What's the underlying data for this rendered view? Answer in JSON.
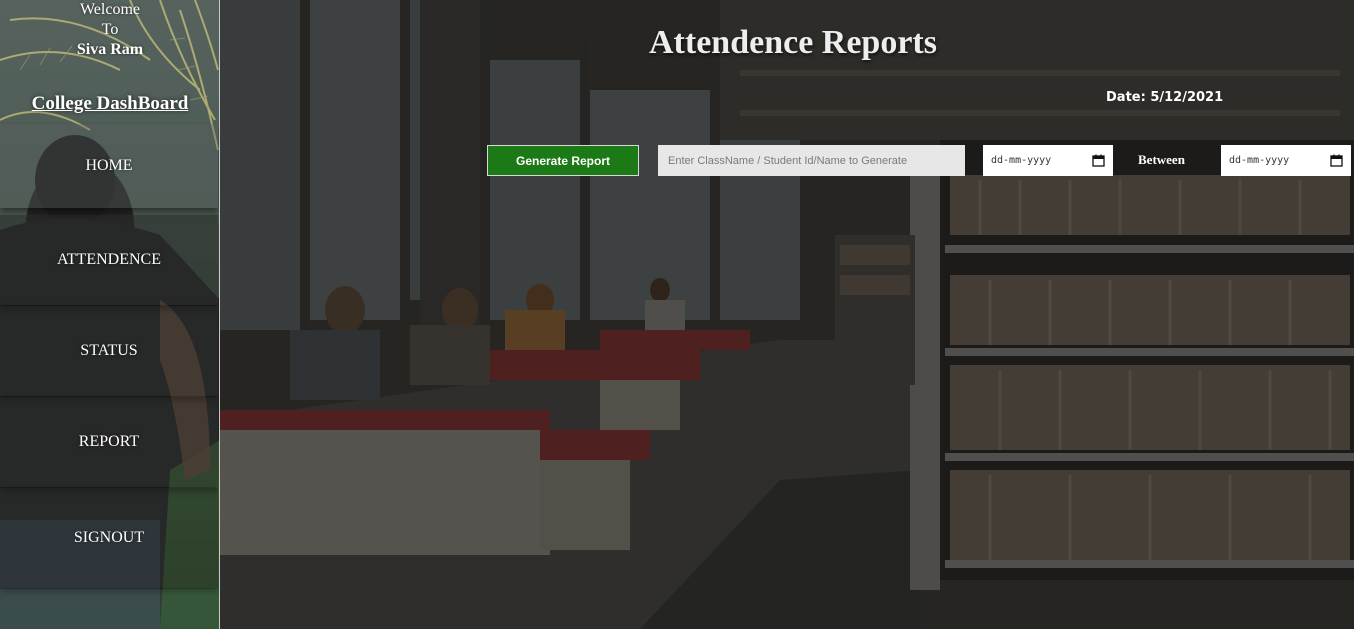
{
  "sidebar": {
    "welcome": "Welcome",
    "to": "To",
    "user": "Siva Ram",
    "brand": "College DashBoard",
    "items": [
      {
        "label": "HOME"
      },
      {
        "label": "ATTENDENCE"
      },
      {
        "label": "STATUS"
      },
      {
        "label": "REPORT"
      },
      {
        "label": "SIGNOUT"
      }
    ]
  },
  "main": {
    "title": "Attendence Reports",
    "date_label": "Date:",
    "date_value": "5/12/2021",
    "generate_button": "Generate Report",
    "search_placeholder": "Enter ClassName / Student Id/Name to Generate",
    "from_date_placeholder": "dd-mm-yyyy",
    "between_label": "Between",
    "to_date_placeholder": "dd-mm-yyyy"
  },
  "icons": {
    "calendar": "calendar-icon"
  },
  "colors": {
    "generate_button_bg": "#1c7a16",
    "overlay": "#2b2a28"
  }
}
